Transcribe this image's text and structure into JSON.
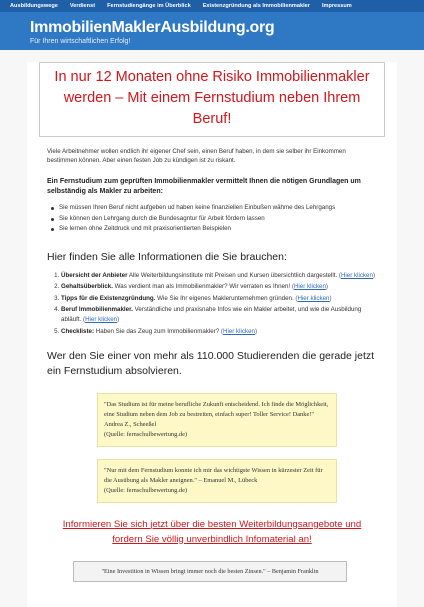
{
  "nav": {
    "items": [
      {
        "label": "Ausbildungswege"
      },
      {
        "label": "Verdienst"
      },
      {
        "label": "Fernstudiengänge im Überblick"
      },
      {
        "label": "Existenzgründung als Immobilienmakler"
      },
      {
        "label": "Impressum"
      }
    ]
  },
  "header": {
    "title": "ImmobilienMaklerAusbildung.org",
    "subtitle": "Für Ihren wirtschaftlichen Erfolg!"
  },
  "main": {
    "headline": "In nur 12 Monaten ohne Risiko Immobilienmakler werden – Mit einem Fernstudium neben Ihrem Beruf!",
    "intro": "Viele Arbeitnehmer wollen endlich ihr eigener Chef sein, einen Beruf haben, in dem sie selber ihr Einkommen bestimmen können. Aber einen festen Job zu kündigen ist zu riskant.",
    "bold_intro": "Ein Fernstudium zum geprüften Immobilienmakler vermittelt Ihnen die nötigen Grundlagen um selbständig als Makler zu arbeiten:",
    "benefits": [
      "Sie müssen Ihren Beruf nicht aufgeben ud haben keine finanziellen Einbußen wähme des Lehrgangs",
      "Sie können den Lehrgang durch die Bundesagntur für Arbeit fördern lassen",
      "Sie lernen ohne Zeitdruck und mit praxisorientierten Beispielen"
    ],
    "info_heading": "Hier finden Sie alle Informationen die Sie brauchen:",
    "link_text": "Hier klicken",
    "info_list": [
      {
        "title": "Übersicht der Anbieter",
        "text": " Alle Weiterbildungsinstitute mit Preisen und Kursen übersichtlich dargestellt. "
      },
      {
        "title": "Gehaltsüberblick.",
        "text": " Was verdient man als Immobilienmakler? Wir verraten es Ihnen! "
      },
      {
        "title": "Tipps für die Existenzgründung.",
        "text": " Wie Sie Ihr eigenes Maklerunternehmen gründen. "
      },
      {
        "title": "Beruf Immobilienmakler.",
        "text": " Verständliche und praxisnahe Infos wie ein Makler arbeitet, und wie die Ausbildung abläuft. "
      },
      {
        "title": "Checkliste:",
        "text": " Haben Sie das Zeug zum Immobilienmakler? "
      }
    ],
    "big_statement": "Wer den Sie einer von mehr als 110.000 Studierenden die gerade jetzt ein Fernstudium absolvieren.",
    "quotes": [
      {
        "text": "\"Das Studium ist für meine berufliche Zukunft entscheidend. Ich finde die Möglichkeit, eine Studium neben dem Job zu bestreiten, einfach super! Toller Service! Danke!\" Andrea Z., Scheeßel",
        "source": "(Quelle: fernschulbewertung.de)"
      },
      {
        "text": "\"Nur mit dem Fernstudium konnte ich mir das wichtigste Wissen in kürzester Zeit für die Ausübung als Makler aneignen.\" – Emanuel M., Lübeck",
        "source": "(Quelle: fernschulbewertung.de)"
      }
    ],
    "cta": "Informieren Sie sich jetzt über die besten Weiterbildungsangebote und fordern Sie völlig unverbindlich Infomaterial an!",
    "footer_quote": "\"Eine Investition in Wissen bringt immer noch die besten Zinsen.\" – Benjamin Franklin"
  }
}
